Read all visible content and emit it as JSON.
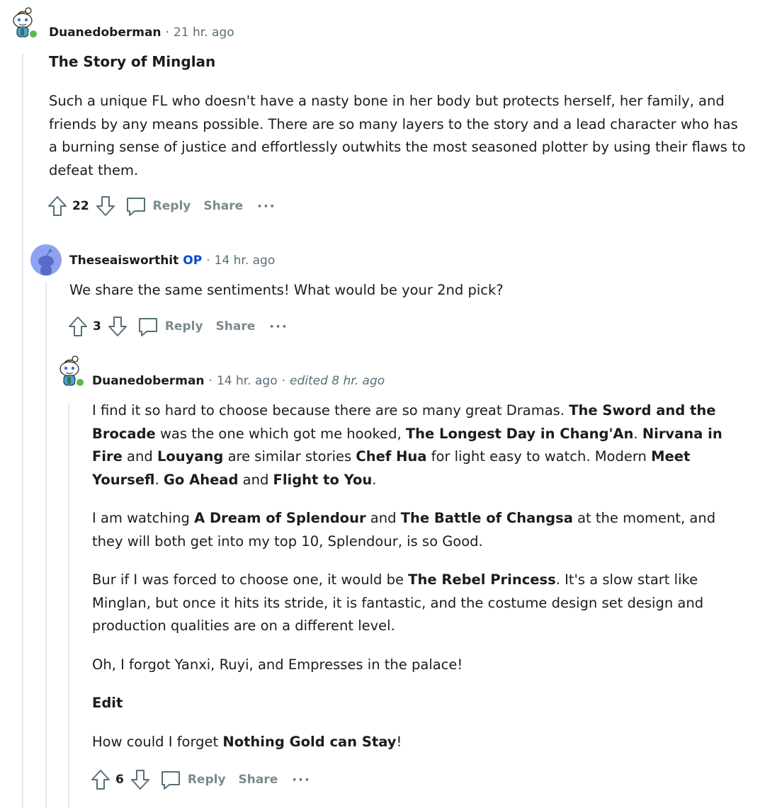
{
  "comments": [
    {
      "author": "Duanedoberman",
      "time": "21 hr. ago",
      "title": "The Story of Minglan",
      "body": "Such a unique FL who doesn't have a nasty bone in her body but protects herself, her family, and friends by any means possible. There are so many layers to the story and a lead character who has a burning sense of justice and effortlessly outwhits the most seasoned plotter by using their flaws to defeat them.",
      "score": "22",
      "reply_label": "Reply",
      "share_label": "Share",
      "more_label": "···"
    },
    {
      "author": "Theseaisworthit",
      "badge": "OP",
      "time": "14 hr. ago",
      "body": "We share the same sentiments! What would be your 2nd pick?",
      "score": "3",
      "reply_label": "Reply",
      "share_label": "Share",
      "more_label": "···"
    },
    {
      "author": "Duanedoberman",
      "time": "14 hr. ago",
      "edited": "edited 8 hr. ago",
      "paragraphs": [
        [
          {
            "t": "I find it so hard to choose because there are so many great Dramas. "
          },
          {
            "t": "The Sword and the Brocade",
            "b": true
          },
          {
            "t": " was the one which got me hooked, "
          },
          {
            "t": "The Longest Day in Chang'An",
            "b": true
          },
          {
            "t": ". "
          },
          {
            "t": "Nirvana in Fire",
            "b": true
          },
          {
            "t": " and "
          },
          {
            "t": "Louyang",
            "b": true
          },
          {
            "t": " are similar stories "
          },
          {
            "t": "Chef Hua",
            "b": true
          },
          {
            "t": " for light easy to watch. Modern "
          },
          {
            "t": "Meet Yoursefl",
            "b": true
          },
          {
            "t": ". "
          },
          {
            "t": "Go Ahead",
            "b": true
          },
          {
            "t": " and "
          },
          {
            "t": "Flight to You",
            "b": true
          },
          {
            "t": "."
          }
        ],
        [
          {
            "t": "I am watching "
          },
          {
            "t": "A Dream of Splendour",
            "b": true
          },
          {
            "t": " and "
          },
          {
            "t": "The Battle of Changsa",
            "b": true
          },
          {
            "t": " at the moment, and they will both get into my top 10, Splendour, is so Good."
          }
        ],
        [
          {
            "t": "Bur if I was forced to choose one, it would be "
          },
          {
            "t": "The Rebel Princess",
            "b": true
          },
          {
            "t": ". It's a slow start like Minglan, but once it hits its stride, it is fantastic, and the costume design set design and production qualities are on a different level."
          }
        ],
        [
          {
            "t": "Oh, I forgot Yanxi, Ruyi, and Empresses in the palace!"
          }
        ],
        [
          {
            "t": "Edit",
            "b": true
          }
        ],
        [
          {
            "t": "How could I forget "
          },
          {
            "t": "Nothing Gold can Stay",
            "b": true
          },
          {
            "t": "!"
          }
        ]
      ],
      "score": "6",
      "reply_label": "Reply",
      "share_label": "Share",
      "more_label": "···"
    }
  ],
  "icons": {
    "upvote": "upvote-arrow-icon",
    "downvote": "downvote-arrow-icon",
    "reply": "speech-bubble-icon",
    "online": "online-status-dot"
  },
  "colors": {
    "op_badge": "#0a49d1",
    "online_dot": "#55bd46",
    "avatar_blue": "#8ea2f0",
    "thread_line": "#e5e8ea"
  }
}
